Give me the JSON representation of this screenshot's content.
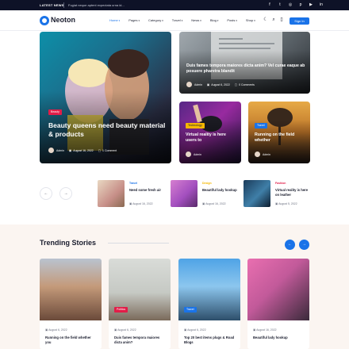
{
  "topbar": {
    "latest_label": "LATEST NEWS",
    "ticker": "Fugiat neque aptent expectata urna id...",
    "social_icons": [
      "facebook-icon",
      "twitter-icon",
      "instagram-icon",
      "pinterest-icon",
      "youtube-icon",
      "linkedin-icon"
    ]
  },
  "header": {
    "logo_text": "Neoton",
    "nav": [
      {
        "label": "Home",
        "active": true
      },
      {
        "label": "Pages",
        "active": false
      },
      {
        "label": "Category",
        "active": false
      },
      {
        "label": "Travel",
        "active": false
      },
      {
        "label": "News",
        "active": false
      },
      {
        "label": "Blog",
        "active": false
      },
      {
        "label": "Posts",
        "active": false
      },
      {
        "label": "Shop",
        "active": false
      }
    ],
    "signin_label": "Sign In",
    "accent_color": "#1a73e8"
  },
  "hero": {
    "main": {
      "tag": "Beauty",
      "title": "Beauty queens need beauty material & products",
      "author": "Admin",
      "date": "August 16, 2022",
      "comments": "1 Comment"
    },
    "top_right": {
      "title": "Duis fames tempora maiores dicta anim? Vel curae eaque ab posuere pharetra blandit",
      "author": "Admin",
      "date": "August 6, 2022",
      "comments": "0 Comments"
    },
    "small": [
      {
        "tag": "Technology",
        "title": "Virtual reality is here users to",
        "author": "Admin"
      },
      {
        "tag": "Travel",
        "title": "Running on the field whether",
        "author": "Admin"
      }
    ]
  },
  "slider": {
    "items": [
      {
        "category": "Travel",
        "title": "Need some fresh air",
        "date": "August 16, 2022"
      },
      {
        "category": "Design",
        "title": "Beautiful lady hookup",
        "date": "August 16, 2022"
      },
      {
        "category": "Fashion",
        "title": "Virtual reality is here on leather",
        "date": "August 5, 2022"
      }
    ]
  },
  "trending": {
    "title": "Trending Stories",
    "cards": [
      {
        "tag": "",
        "date": "August 6, 2022",
        "title": "Running on the field whether you"
      },
      {
        "tag": "Politics",
        "date": "August 6, 2022",
        "title": "Duis fames tempora maiores dicta anim?"
      },
      {
        "tag": "Travel",
        "date": "August 6, 2022",
        "title": "Top 20 best items plugs & Road Blogs"
      },
      {
        "tag": "",
        "date": "August 16, 2022",
        "title": "Beautiful lady hookup"
      }
    ]
  }
}
